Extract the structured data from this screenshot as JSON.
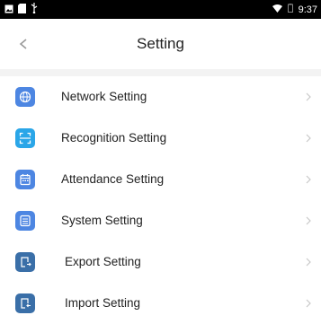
{
  "status_bar": {
    "time": "9:37",
    "left_icons": [
      "image-icon",
      "sd-card-icon",
      "usb-icon"
    ],
    "right_icons": [
      "wifi-icon",
      "battery-icon"
    ]
  },
  "header": {
    "title": "Setting",
    "back_icon": "chevron-left-icon"
  },
  "settings": [
    {
      "label": "Network Setting",
      "icon": "globe-icon",
      "color": "#4d86e2"
    },
    {
      "label": "Recognition Setting",
      "icon": "scan-icon",
      "color": "#2aa6e8"
    },
    {
      "label": "Attendance Setting",
      "icon": "calendar-icon",
      "color": "#4d86e2"
    },
    {
      "label": "System Setting",
      "icon": "list-icon",
      "color": "#4d86e2"
    },
    {
      "label": "Export Setting",
      "icon": "export-icon",
      "color": "#3a6fa8"
    },
    {
      "label": "Import Setting",
      "icon": "import-icon",
      "color": "#3a6fa8"
    }
  ],
  "colors": {
    "status_bar": "#000000",
    "section_gap": "#f3f3f3",
    "text": "#222222",
    "chevron": "#c8c8c8"
  }
}
